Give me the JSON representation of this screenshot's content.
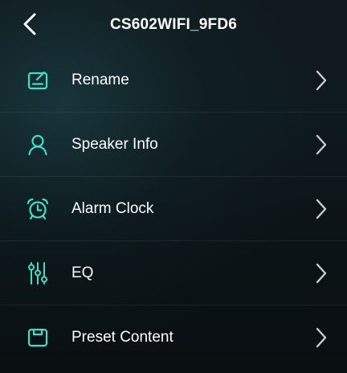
{
  "header": {
    "title": "CS602WIFI_9FD6",
    "back_icon": "chevron-left-icon"
  },
  "menu": {
    "items": [
      {
        "label": "Rename",
        "icon": "edit-icon"
      },
      {
        "label": "Speaker Info",
        "icon": "user-icon"
      },
      {
        "label": "Alarm Clock",
        "icon": "alarm-clock-icon"
      },
      {
        "label": "EQ",
        "icon": "equalizer-icon"
      },
      {
        "label": "Preset Content",
        "icon": "preset-icon"
      }
    ]
  },
  "colors": {
    "accent": "#3ddfc9",
    "text": "#ffffff",
    "chevron": "#c9cdd0"
  }
}
